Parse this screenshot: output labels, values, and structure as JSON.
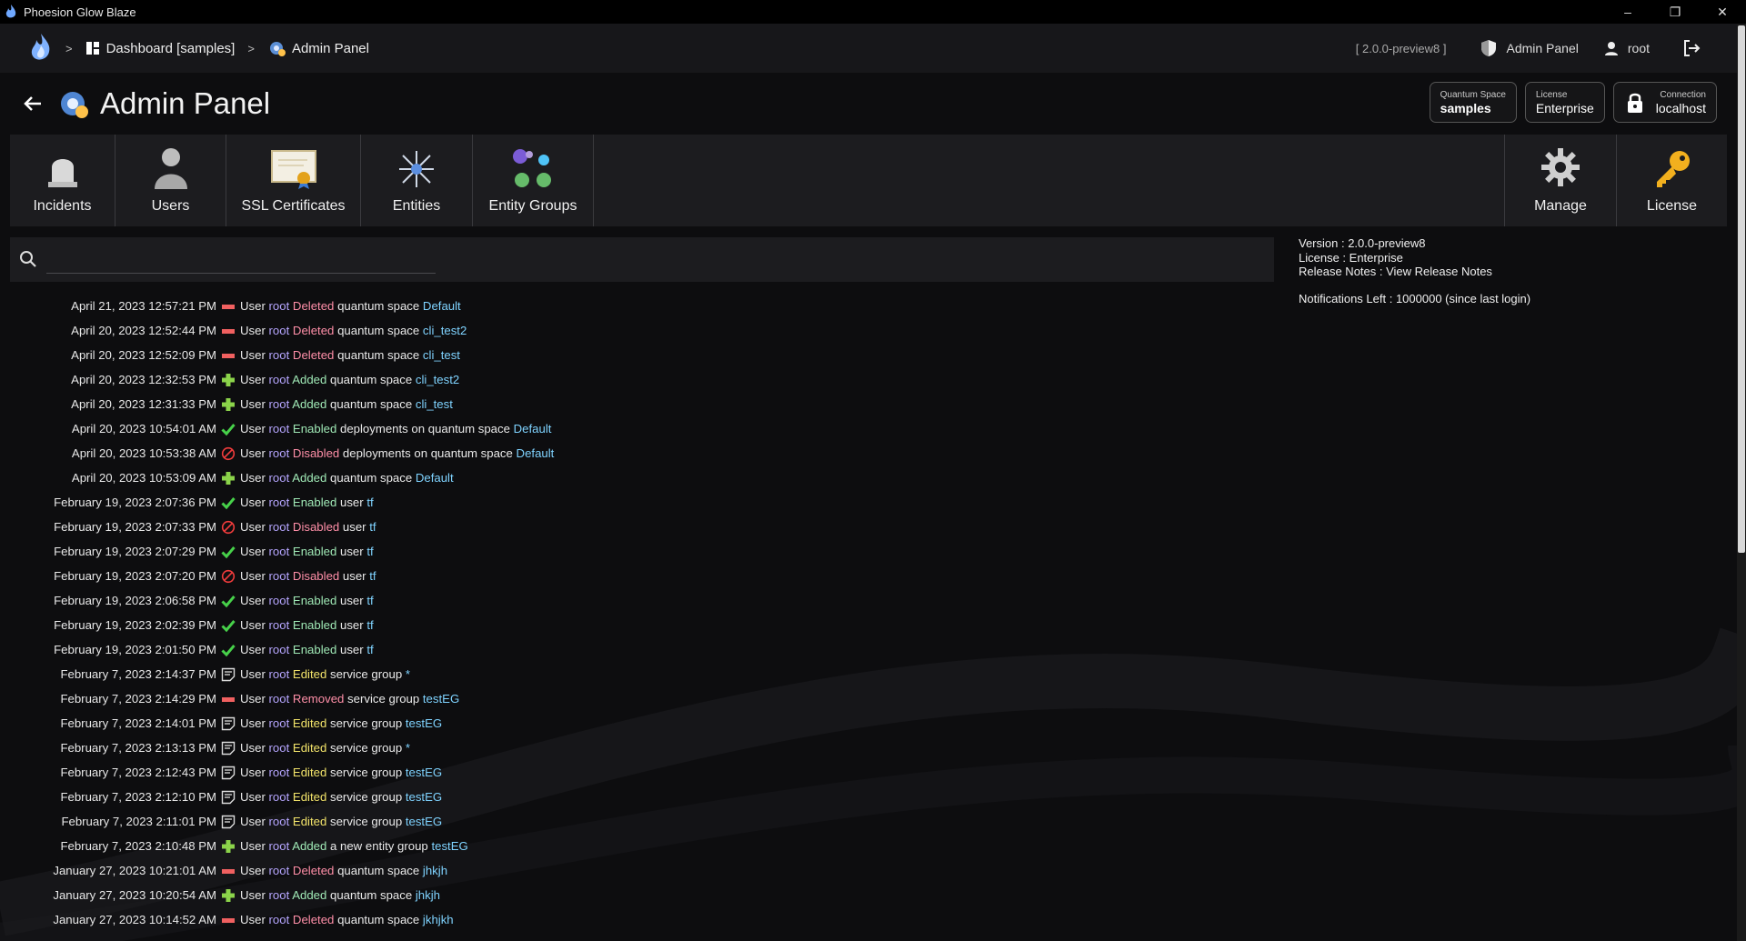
{
  "window": {
    "title": "Phoesion Glow Blaze"
  },
  "breadcrumb": {
    "dashboard": "Dashboard [samples]",
    "current": "Admin Panel",
    "separator": ">"
  },
  "nav": {
    "version": "[ 2.0.0-preview8 ]",
    "admin_panel": "Admin Panel",
    "user": "root"
  },
  "header": {
    "title": "Admin Panel"
  },
  "chips": {
    "quantum_space": {
      "label": "Quantum Space",
      "value": "samples"
    },
    "license": {
      "label": "License",
      "value": "Enterprise"
    },
    "connection": {
      "label": "Connection",
      "value": "localhost"
    }
  },
  "toolbar": {
    "incidents": "Incidents",
    "users": "Users",
    "ssl": "SSL Certificates",
    "entities": "Entities",
    "entity_groups": "Entity Groups",
    "manage": "Manage",
    "license": "License"
  },
  "search": {
    "placeholder": ""
  },
  "info": {
    "version": "Version : 2.0.0-preview8",
    "license": "License : Enterprise",
    "release_notes": "Release Notes : View Release Notes",
    "notifications": "Notifications Left : 1000000 (since last login)"
  },
  "colors": {
    "accent_user": "#b6a6ff",
    "deleted": "#ff8fa8",
    "added": "#9fe8b5",
    "edited": "#f2e36a",
    "target": "#7fd3ff"
  },
  "log": [
    {
      "ts": "April 21, 2023 12:57:21 PM",
      "icon": "remove-icon",
      "pre": "User",
      "user": "root",
      "action": "Deleted",
      "akind": "deleted",
      "obj": "quantum space",
      "target": "Default"
    },
    {
      "ts": "April 20, 2023 12:52:44 PM",
      "icon": "remove-icon",
      "pre": "User",
      "user": "root",
      "action": "Deleted",
      "akind": "deleted",
      "obj": "quantum space",
      "target": "cli_test2"
    },
    {
      "ts": "April 20, 2023 12:52:09 PM",
      "icon": "remove-icon",
      "pre": "User",
      "user": "root",
      "action": "Deleted",
      "akind": "deleted",
      "obj": "quantum space",
      "target": "cli_test"
    },
    {
      "ts": "April 20, 2023 12:32:53 PM",
      "icon": "add-icon",
      "pre": "User",
      "user": "root",
      "action": "Added",
      "akind": "added",
      "obj": "quantum space",
      "target": "cli_test2"
    },
    {
      "ts": "April 20, 2023 12:31:33 PM",
      "icon": "add-icon",
      "pre": "User",
      "user": "root",
      "action": "Added",
      "akind": "added",
      "obj": "quantum space",
      "target": "cli_test"
    },
    {
      "ts": "April 20, 2023 10:54:01 AM",
      "icon": "check-icon",
      "pre": "User",
      "user": "root",
      "action": "Enabled",
      "akind": "enabled",
      "obj": "deployments on quantum space",
      "target": "Default"
    },
    {
      "ts": "April 20, 2023 10:53:38 AM",
      "icon": "disabled-icon",
      "pre": "User",
      "user": "root",
      "action": "Disabled",
      "akind": "disabled",
      "obj": "deployments on quantum space",
      "target": "Default"
    },
    {
      "ts": "April 20, 2023 10:53:09 AM",
      "icon": "add-icon",
      "pre": "User",
      "user": "root",
      "action": "Added",
      "akind": "added",
      "obj": "quantum space",
      "target": "Default"
    },
    {
      "ts": "February 19, 2023 2:07:36 PM",
      "icon": "check-icon",
      "pre": "User",
      "user": "root",
      "action": "Enabled",
      "akind": "enabled",
      "obj": "user",
      "target": "tf"
    },
    {
      "ts": "February 19, 2023 2:07:33 PM",
      "icon": "disabled-icon",
      "pre": "User",
      "user": "root",
      "action": "Disabled",
      "akind": "disabled",
      "obj": "user",
      "target": "tf"
    },
    {
      "ts": "February 19, 2023 2:07:29 PM",
      "icon": "check-icon",
      "pre": "User",
      "user": "root",
      "action": "Enabled",
      "akind": "enabled",
      "obj": "user",
      "target": "tf"
    },
    {
      "ts": "February 19, 2023 2:07:20 PM",
      "icon": "disabled-icon",
      "pre": "User",
      "user": "root",
      "action": "Disabled",
      "akind": "disabled",
      "obj": "user",
      "target": "tf"
    },
    {
      "ts": "February 19, 2023 2:06:58 PM",
      "icon": "check-icon",
      "pre": "User",
      "user": "root",
      "action": "Enabled",
      "akind": "enabled",
      "obj": "user",
      "target": "tf"
    },
    {
      "ts": "February 19, 2023 2:02:39 PM",
      "icon": "check-icon",
      "pre": "User",
      "user": "root",
      "action": "Enabled",
      "akind": "enabled",
      "obj": "user",
      "target": "tf"
    },
    {
      "ts": "February 19, 2023 2:01:50 PM",
      "icon": "check-icon",
      "pre": "User",
      "user": "root",
      "action": "Enabled",
      "akind": "enabled",
      "obj": "user",
      "target": "tf"
    },
    {
      "ts": "February 7, 2023 2:14:37 PM",
      "icon": "edit-icon",
      "pre": "User",
      "user": "root",
      "action": "Edited",
      "akind": "edited",
      "obj": "service group",
      "target": "*"
    },
    {
      "ts": "February 7, 2023 2:14:29 PM",
      "icon": "remove-icon",
      "pre": "User",
      "user": "root",
      "action": "Removed",
      "akind": "removed",
      "obj": "service group",
      "target": "testEG"
    },
    {
      "ts": "February 7, 2023 2:14:01 PM",
      "icon": "edit-icon",
      "pre": "User",
      "user": "root",
      "action": "Edited",
      "akind": "edited",
      "obj": "service group",
      "target": "testEG"
    },
    {
      "ts": "February 7, 2023 2:13:13 PM",
      "icon": "edit-icon",
      "pre": "User",
      "user": "root",
      "action": "Edited",
      "akind": "edited",
      "obj": "service group",
      "target": "*"
    },
    {
      "ts": "February 7, 2023 2:12:43 PM",
      "icon": "edit-icon",
      "pre": "User",
      "user": "root",
      "action": "Edited",
      "akind": "edited",
      "obj": "service group",
      "target": "testEG"
    },
    {
      "ts": "February 7, 2023 2:12:10 PM",
      "icon": "edit-icon",
      "pre": "User",
      "user": "root",
      "action": "Edited",
      "akind": "edited",
      "obj": "service group",
      "target": "testEG"
    },
    {
      "ts": "February 7, 2023 2:11:01 PM",
      "icon": "edit-icon",
      "pre": "User",
      "user": "root",
      "action": "Edited",
      "akind": "edited",
      "obj": "service group",
      "target": "testEG"
    },
    {
      "ts": "February 7, 2023 2:10:48 PM",
      "icon": "add-icon",
      "pre": "User",
      "user": "root",
      "action": "Added",
      "akind": "added",
      "obj": "a new entity group",
      "target": "testEG"
    },
    {
      "ts": "January 27, 2023 10:21:01 AM",
      "icon": "remove-icon",
      "pre": "User",
      "user": "root",
      "action": "Deleted",
      "akind": "deleted",
      "obj": "quantum space",
      "target": "jhkjh"
    },
    {
      "ts": "January 27, 2023 10:20:54 AM",
      "icon": "add-icon",
      "pre": "User",
      "user": "root",
      "action": "Added",
      "akind": "added",
      "obj": "quantum space",
      "target": "jhkjh"
    },
    {
      "ts": "January 27, 2023 10:14:52 AM",
      "icon": "remove-icon",
      "pre": "User",
      "user": "root",
      "action": "Deleted",
      "akind": "deleted",
      "obj": "quantum space",
      "target": "jkhjkh"
    }
  ]
}
